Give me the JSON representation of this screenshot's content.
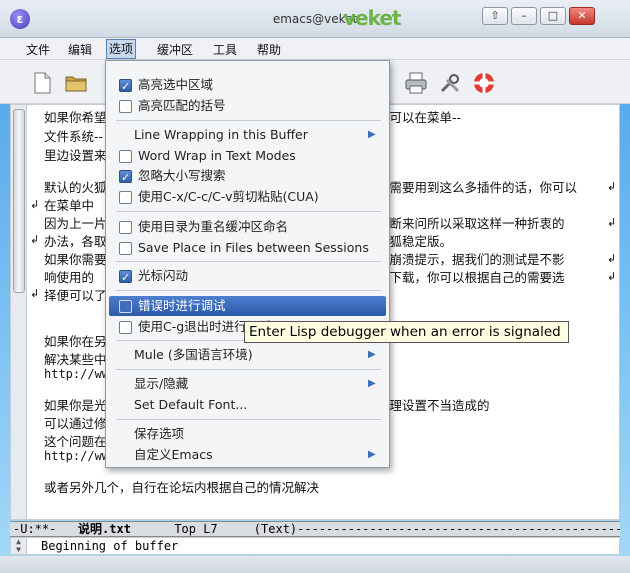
{
  "window": {
    "title": "emacs@veket",
    "logo_text": "veket",
    "buttons": [
      "⇧",
      "–",
      "□",
      "✕"
    ]
  },
  "menubar": {
    "items": [
      "文件",
      "编辑",
      "选项",
      "缓冲区",
      "工具",
      "帮助"
    ]
  },
  "toolbar": {
    "icons": [
      "new-file-icon",
      "open-folder-icon",
      "print-icon",
      "preferences-icon",
      "help-icon"
    ]
  },
  "editor": {
    "lines": [
      "如果你希望",
      "文件系统--",
      "里边设置来",
      "默认的火狐",
      "在菜单中",
      "因为上一片",
      "办法，各取",
      "如果你需要",
      "响使用的",
      "择便可以了",
      "如果你在另",
      "解决某些中",
      "http://ww",
      "如果你是光",
      "可以通过修",
      "这个问题在",
      "http://ww",
      "或者另外几个，自行在论坛内根据自己的情况解决"
    ],
    "right_fragments": [
      "你可以在菜单--",
      "不需要用到这么多插件的话，你可以",
      "不断来问所以采取这样一种折衷的",
      "火狐稳定版。",
      "个崩溃提示，据我们的测试是不影",
      "上下载，你可以根据自己的需要选",
      "原理设置不当造成的"
    ],
    "wrap_glyph": "↲"
  },
  "modeline": {
    "status": "-U:**-",
    "buffer": "说明.txt",
    "position": "Top L7",
    "mode": "(Text)"
  },
  "echo": {
    "text": "Beginning of buffer"
  },
  "dropdown": {
    "items": [
      {
        "label": "高亮选中区域",
        "checked": true
      },
      {
        "label": "高亮匹配的括号",
        "checked": false
      },
      {
        "label": "Line Wrapping in this Buffer",
        "submenu": true
      },
      {
        "label": "Word Wrap in Text Modes",
        "checked": false
      },
      {
        "label": "忽略大小写搜索",
        "checked": true
      },
      {
        "label": "使用C-x/C-c/C-v剪切粘贴(CUA)",
        "checked": false
      },
      {
        "label": "使用目录为重名缓冲区命名",
        "checked": false
      },
      {
        "label": "Save Place in Files between Sessions",
        "checked": false
      },
      {
        "label": "光标闪动",
        "checked": true
      },
      {
        "label": "错误时进行调试",
        "checked": false,
        "highlighted": true
      },
      {
        "label": "使用C-g退出时进行调试",
        "checked": false
      },
      {
        "label": "Mule (多国语言环境)",
        "submenu": true
      },
      {
        "label": "显示/隐藏",
        "submenu": true
      },
      {
        "label": "Set Default Font..."
      },
      {
        "label": "保存选项"
      },
      {
        "label": "自定义Emacs",
        "submenu": true
      }
    ],
    "arrow_glyph": "▶"
  },
  "tooltip": {
    "text": "Enter Lisp debugger when an error is signaled"
  },
  "colors": {
    "highlight": "#2d59a8",
    "tooltip_bg": "#ffffe1",
    "desktop": "#4aa0e8"
  }
}
